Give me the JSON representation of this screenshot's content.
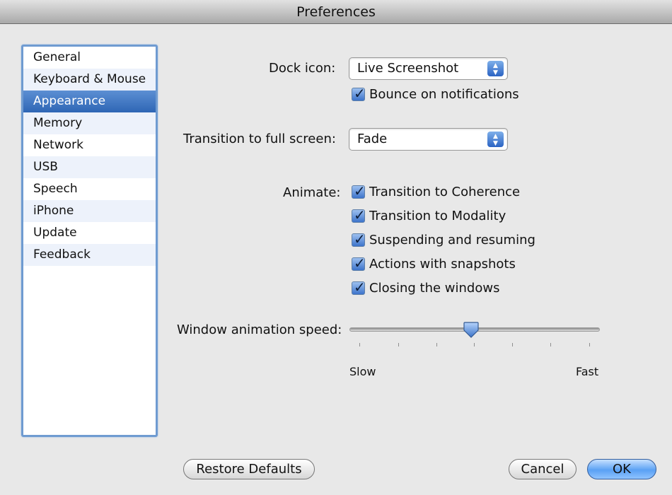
{
  "window": {
    "title": "Preferences"
  },
  "sidebar": {
    "items": [
      {
        "label": "General"
      },
      {
        "label": "Keyboard & Mouse"
      },
      {
        "label": "Appearance",
        "selected": true
      },
      {
        "label": "Memory"
      },
      {
        "label": "Network"
      },
      {
        "label": "USB"
      },
      {
        "label": "Speech"
      },
      {
        "label": "iPhone"
      },
      {
        "label": "Update"
      },
      {
        "label": "Feedback"
      }
    ]
  },
  "appearance": {
    "dock_icon": {
      "label": "Dock icon:",
      "value": "Live Screenshot",
      "bounce": {
        "label": "Bounce on notifications",
        "checked": true
      }
    },
    "transition": {
      "label": "Transition to full screen:",
      "value": "Fade"
    },
    "animate": {
      "label": "Animate:",
      "options": [
        {
          "label": "Transition to Coherence",
          "checked": true
        },
        {
          "label": "Transition to Modality",
          "checked": true
        },
        {
          "label": "Suspending and resuming",
          "checked": true
        },
        {
          "label": "Actions with snapshots",
          "checked": true
        },
        {
          "label": "Closing the windows",
          "checked": true
        }
      ]
    },
    "speed": {
      "label": "Window animation speed:",
      "min_label": "Slow",
      "max_label": "Fast",
      "value_fraction": 0.5
    }
  },
  "buttons": {
    "restore": "Restore Defaults",
    "cancel": "Cancel",
    "ok": "OK"
  },
  "colors": {
    "selection": "#2e66b5",
    "accent": "#5aa1f4"
  }
}
